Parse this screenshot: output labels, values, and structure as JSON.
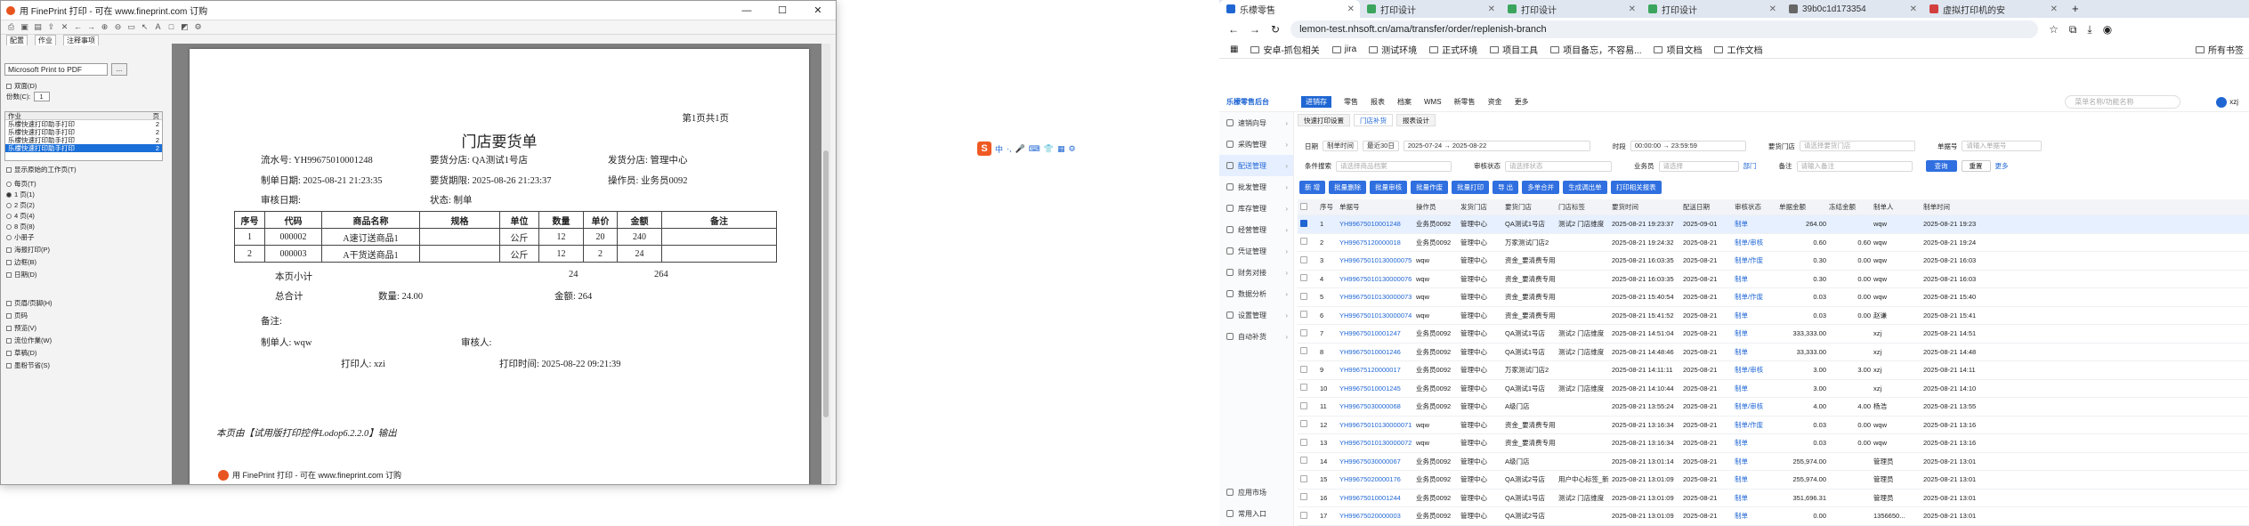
{
  "fineprint": {
    "title": "用 FinePrint 打印 - 可在 www.fineprint.com 订购",
    "window_buttons": [
      "—",
      "☐",
      "✕"
    ],
    "tabs": [
      "配置",
      "作业",
      "注释事项"
    ],
    "printer": "Microsoft Print to PDF",
    "printer_btn": "...",
    "checkbox_verso": "双面(D)",
    "copies_label": "份数(C):",
    "copies_value": "1",
    "joblist_headers": [
      "作业",
      "页"
    ],
    "jobs": [
      {
        "name": "乐檬快速打印助手打印",
        "pages": "2"
      },
      {
        "name": "乐檬快速打印助手打印",
        "pages": "2"
      },
      {
        "name": "乐檬快速打印助手打印",
        "pages": "2"
      },
      {
        "name": "乐檬快速打印助手打印",
        "pages": "2"
      }
    ],
    "opt_preview": "显示原始的工作页(T)",
    "radio_title": "每页(T)",
    "radios": [
      "1 页(1)",
      "2 页(2)",
      "4 页(4)",
      "8 页(8)",
      "小册子"
    ],
    "checks": [
      "海报打印(P)",
      "边框(B)",
      "日期(D)",
      "页眉/页脚(H)",
      "页码",
      "预览(V)",
      "流位作業(W)",
      "草稿(D)",
      "墨粉节省(S)"
    ],
    "footer": "用 FinePrint 打印 - 可在 www.fineprint.com 订购"
  },
  "doc": {
    "page_no": "第1页共1页",
    "title": "门店要货单",
    "fields": [
      {
        "k": "流水号:",
        "v": "YH99675010001248"
      },
      {
        "k": "要货分店:",
        "v": "QA测试1号店"
      },
      {
        "k": "发货分店:",
        "v": "管理中心"
      },
      {
        "k": "制单日期:",
        "v": "2025-08-21 21:23:35"
      },
      {
        "k": "要货期限:",
        "v": "2025-08-26 21:23:37"
      },
      {
        "k": "操作员:",
        "v": "业务员0092"
      },
      {
        "k": "审核日期:",
        "v": ""
      },
      {
        "k": "状态:",
        "v": "制单"
      }
    ],
    "table_headers": [
      "序号",
      "代码",
      "商品名称",
      "规格",
      "单位",
      "数量",
      "单价",
      "金额",
      "备注"
    ],
    "rows": [
      [
        "1",
        "000002",
        "A速订送商品1",
        "",
        "公斤",
        "12",
        "20",
        "240",
        ""
      ],
      [
        "2",
        "000003",
        "A干货送商品1",
        "",
        "公斤",
        "12",
        "2",
        "24",
        ""
      ]
    ],
    "page_subtotal_label": "本页小计",
    "page_subtotal_qty": "24",
    "page_subtotal_amt": "264",
    "total_label": "总合计",
    "total_qty": "数量: 24.00",
    "total_amt": "金额: 264",
    "remark": "备注:",
    "maker": "制单人: wqw",
    "auditor": "审核人:",
    "printer": "打印人: xzi",
    "print_time": "打印时间: 2025-08-22 09:21:39",
    "footer_note": "本页由【试用版打印控件Lodop6.2.2.0】输出",
    "fp_footer": "用 FinePrint 打印 - 可在 www.fineprint.com 订购"
  },
  "ime": {
    "logo": "S",
    "items": [
      "中",
      "·,",
      "🎤",
      "⌨",
      "👕",
      "▦",
      "⚙"
    ]
  },
  "chrome": {
    "tabs": [
      {
        "title": "乐檬零售",
        "color": "#1f66d3",
        "active": true
      },
      {
        "title": "打印设计",
        "color": "#3ba55d",
        "active": false
      },
      {
        "title": "打印设计",
        "color": "#3ba55d",
        "active": false
      },
      {
        "title": "打印设计",
        "color": "#3ba55d",
        "active": false
      },
      {
        "title": "39b0c1d173354",
        "color": "#666666",
        "active": false
      },
      {
        "title": "虚拟打印机的安",
        "color": "#d33f3f",
        "active": false
      }
    ],
    "new_tab": "+",
    "url": "lemon-test.nhsoft.cn/ama/transfer/order/replenish-branch",
    "bookmarks": [
      "安卓-抓包相关",
      "jira",
      "测试环境",
      "正式环境",
      "项目工具",
      "项目备忘，不容易...",
      "项目文档",
      "工作文档"
    ],
    "all_bookmarks": "所有书签"
  },
  "app": {
    "brand": "乐檬零售后台",
    "topnav": [
      "进销存",
      "零售",
      "报表",
      "档案",
      "WMS",
      "新零售",
      "资金",
      "更多"
    ],
    "search_ph": "菜单名称/功能名称",
    "user": "xzj",
    "sidebar": [
      {
        "label": "速销向导",
        "on": false
      },
      {
        "label": "采购管理",
        "on": false
      },
      {
        "label": "配送管理",
        "on": true
      },
      {
        "label": "批发管理",
        "on": false
      },
      {
        "label": "库存管理",
        "on": false
      },
      {
        "label": "经营管理",
        "on": false
      },
      {
        "label": "凭证管理",
        "on": false
      },
      {
        "label": "财务对接",
        "on": false
      },
      {
        "label": "数据分析",
        "on": false
      },
      {
        "label": "设置管理",
        "on": false
      },
      {
        "label": "自动补货",
        "on": false
      }
    ],
    "side_bottom": [
      "应用市场",
      "常用入口"
    ],
    "subtabs": [
      "快速打印设置",
      "门店补货",
      "报表设计"
    ],
    "filter1": {
      "date_label": "日期",
      "date_type": "制单时间",
      "range": "最近30日",
      "from": "2025-07-24",
      "to": "2025-08-22",
      "time_label": "时段",
      "t1": "00:00:00",
      "t2": "23:59:59",
      "store_label": "要货门店",
      "store_ph": "请选择要货门店",
      "no_label": "单据号",
      "no_ph": "请输入单据号"
    },
    "filter2": {
      "cond_label": "条件搜索",
      "cond_ph": "请选择商品档案",
      "status_label": "审核状态",
      "status_ph": "请选择状态",
      "clerk_label": "业务员",
      "clerk_ph": "请选择",
      "dept": "部门",
      "remark_label": "备注",
      "remark_ph": "请输入备注",
      "query": "查询",
      "reset": "重置",
      "more": "更多"
    },
    "buttons": [
      "新 增",
      "批量删除",
      "批量审核",
      "批量作废",
      "批量打印",
      "导 出",
      "多单合并",
      "生成调出单",
      "打印相关报表"
    ],
    "headers": [
      "序号",
      "单据号",
      "操作员",
      "发货门店",
      "要货门店",
      "门店标签",
      "要货时间",
      "配送日期",
      "审核状态",
      "单据金额",
      "冻结金额",
      "制单人",
      "制单时间"
    ],
    "rows": [
      [
        "1",
        "YH99675010001248",
        "业务员0092",
        "管理中心",
        "QA测试1号店",
        "测试2 门店维度",
        "2025-08-21 19:23:37",
        "2025-09-01",
        "制单",
        "264.00",
        "",
        "wqw",
        "2025-08-21 19:23"
      ],
      [
        "2",
        "YH99675120000018",
        "业务员0092",
        "管理中心",
        "万家测试门店2",
        "",
        "2025-08-21 19:24:32",
        "2025-08-21",
        "制单/审核",
        "0.60",
        "0.60",
        "wqw",
        "2025-08-21 19:24"
      ],
      [
        "3",
        "YH99675010130000075",
        "wqw",
        "管理中心",
        "资金_要清费专用...",
        "",
        "2025-08-21 16:03:35",
        "2025-08-21",
        "制单/作废",
        "0.30",
        "0.00",
        "wqw",
        "2025-08-21 16:03"
      ],
      [
        "4",
        "YH99675010130000076",
        "wqw",
        "管理中心",
        "资金_要清费专用...",
        "",
        "2025-08-21 16:03:35",
        "2025-08-21",
        "制单",
        "0.30",
        "0.00",
        "wqw",
        "2025-08-21 16:03"
      ],
      [
        "5",
        "YH99675010130000073",
        "wqw",
        "管理中心",
        "资金_要清费专用...",
        "",
        "2025-08-21 15:40:54",
        "2025-08-21",
        "制单/作废",
        "0.03",
        "0.00",
        "wqw",
        "2025-08-21 15:40"
      ],
      [
        "6",
        "YH99675010130000074",
        "wqw",
        "管理中心",
        "资金_要清费专用...",
        "",
        "2025-08-21 15:41:52",
        "2025-08-21",
        "制单",
        "0.03",
        "0.00",
        "赵谦",
        "2025-08-21 15:41"
      ],
      [
        "7",
        "YH99675010001247",
        "业务员0092",
        "管理中心",
        "QA测试1号店",
        "测试2 门店维度",
        "2025-08-21 14:51:04",
        "2025-08-21",
        "制单",
        "333,333.00",
        "",
        "xzj",
        "2025-08-21 14:51"
      ],
      [
        "8",
        "YH99675010001246",
        "业务员0092",
        "管理中心",
        "QA测试1号店",
        "测试2 门店维度",
        "2025-08-21 14:48:46",
        "2025-08-21",
        "制单",
        "33,333.00",
        "",
        "xzj",
        "2025-08-21 14:48"
      ],
      [
        "9",
        "YH99675120000017",
        "业务员0092",
        "管理中心",
        "万家测试门店2",
        "",
        "2025-08-21 14:11:11",
        "2025-08-21",
        "制单/审核",
        "3.00",
        "3.00",
        "xzj",
        "2025-08-21 14:11"
      ],
      [
        "10",
        "YH99675010001245",
        "业务员0092",
        "管理中心",
        "QA测试1号店",
        "测试2 门店维度",
        "2025-08-21 14:10:44",
        "2025-08-21",
        "制单",
        "3.00",
        "",
        "xzj",
        "2025-08-21 14:10"
      ],
      [
        "11",
        "YH99675030000068",
        "业务员0092",
        "管理中心",
        "A级门店",
        "",
        "2025-08-21 13:55:24",
        "2025-08-21",
        "制单/审核",
        "4.00",
        "4.00",
        "杨浩",
        "2025-08-21 13:55"
      ],
      [
        "12",
        "YH99675010130000071",
        "wqw",
        "管理中心",
        "资金_要清费专用...",
        "",
        "2025-08-21 13:16:34",
        "2025-08-21",
        "制单/作废",
        "0.03",
        "0.00",
        "wqw",
        "2025-08-21 13:16"
      ],
      [
        "13",
        "YH99675010130000072",
        "wqw",
        "管理中心",
        "资金_要清费专用...",
        "",
        "2025-08-21 13:16:34",
        "2025-08-21",
        "制单",
        "0.03",
        "0.00",
        "wqw",
        "2025-08-21 13:16"
      ],
      [
        "14",
        "YH99675030000067",
        "业务员0092",
        "管理中心",
        "A级门店",
        "",
        "2025-08-21 13:01:14",
        "2025-08-21",
        "制单",
        "255,974.00",
        "",
        "管理员",
        "2025-08-21 13:01"
      ],
      [
        "15",
        "YH99675020000176",
        "业务员0092",
        "管理中心",
        "QA测试2号店",
        "用户中心标签_新...",
        "2025-08-21 13:01:09",
        "2025-08-21",
        "制单",
        "255,974.00",
        "",
        "管理员",
        "2025-08-21 13:01"
      ],
      [
        "16",
        "YH99675010001244",
        "业务员0092",
        "管理中心",
        "QA测试1号店",
        "测试2 门店维度",
        "2025-08-21 13:01:09",
        "2025-08-21",
        "制单",
        "351,696.31",
        "",
        "管理员",
        "2025-08-21 13:01"
      ],
      [
        "17",
        "YH99675020000003",
        "业务员0092",
        "管理中心",
        "QA测试2号店",
        "",
        "2025-08-21 13:01:09",
        "2025-08-21",
        "制单",
        "0.00",
        "",
        "1356650...",
        "2025-08-21 13:01"
      ]
    ]
  }
}
